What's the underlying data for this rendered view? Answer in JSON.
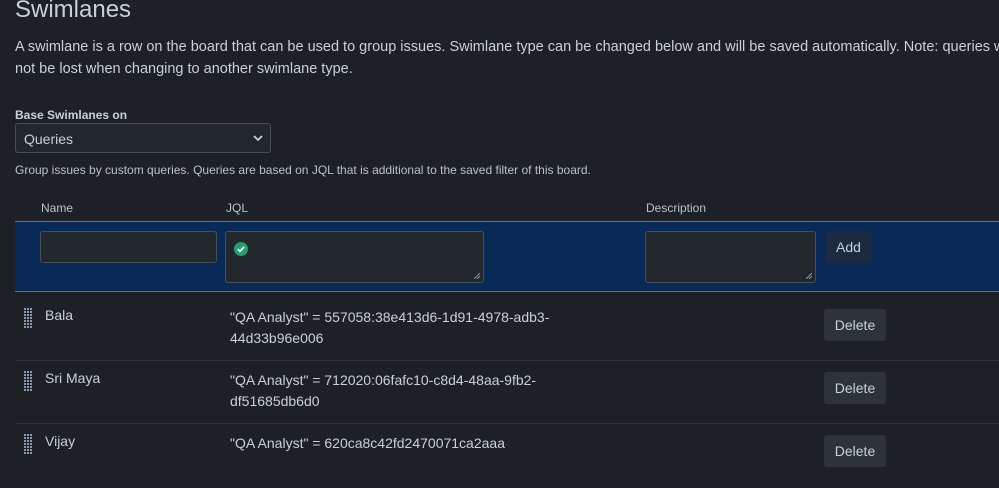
{
  "page": {
    "title": "Swimlanes",
    "intro": "A swimlane is a row on the board that can be used to group issues. Swimlane type can be changed below and will be saved automatically. Note: queries will not be lost when changing to another swimlane type."
  },
  "base_select": {
    "label": "Base Swimlanes on",
    "value": "Queries"
  },
  "help_text": "Group issues by custom queries. Queries are based on JQL that is additional to the saved filter of this board.",
  "table": {
    "headers": {
      "name": "Name",
      "jql": "JQL",
      "description": "Description"
    },
    "add_label": "Add",
    "delete_label": "Delete",
    "rows": [
      {
        "name": "Bala",
        "jql": "\"QA Analyst\" = 557058:38e413d6-1d91-4978-adb3-44d33b96e006"
      },
      {
        "name": "Sri Maya",
        "jql": "\"QA Analyst\" = 712020:06fafc10-c8d4-48aa-9fb2-df51685db6d0"
      },
      {
        "name": "Vijay",
        "jql": "\"QA Analyst\" = 620ca8c42fd2470071ca2aaa"
      }
    ]
  },
  "colors": {
    "background": "#1d2125",
    "selected_row": "#092957",
    "accent": "#1d7afc",
    "valid_check": "#22a06b"
  },
  "icons": [
    "chevron-down-icon",
    "valid-check-icon",
    "resize-grip-icon",
    "drag-handle-icon"
  ]
}
